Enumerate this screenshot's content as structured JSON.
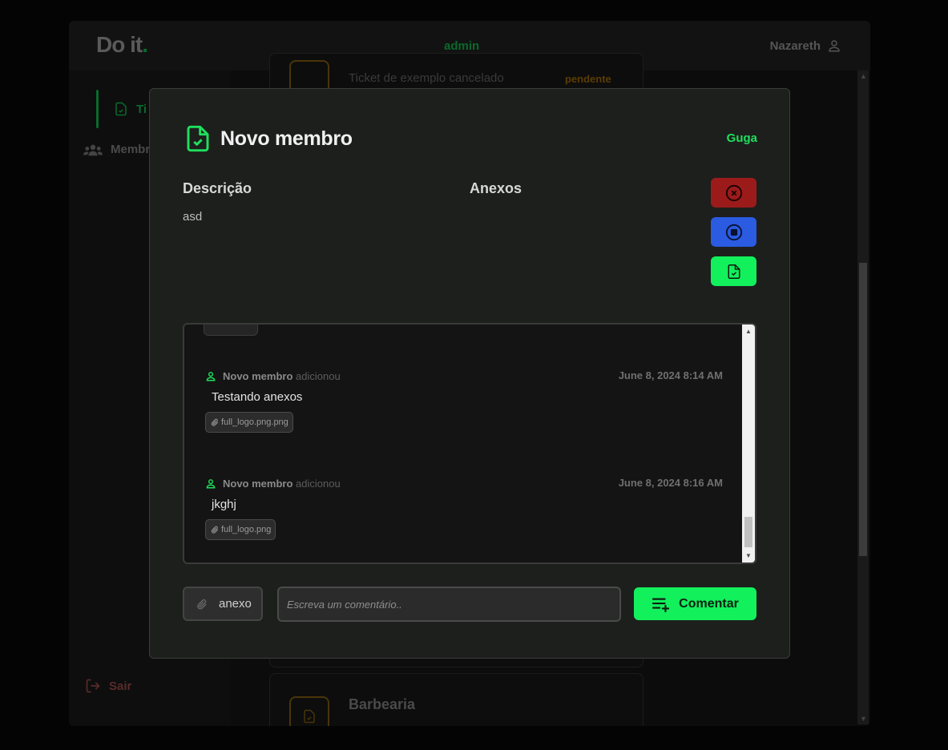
{
  "app": {
    "logo_text": "Do it",
    "logo_dot": ".",
    "role": "admin",
    "user_name": "Nazareth"
  },
  "sidebar": {
    "items": [
      {
        "label": "Ti"
      },
      {
        "label": "Membr"
      }
    ],
    "logout_label": "Sair"
  },
  "background_cards": [
    {
      "title": "Ticket de exemplo cancelado",
      "status": "pendente"
    },
    {
      "title": "Barbearia"
    }
  ],
  "modal": {
    "title": "Novo membro",
    "assignee": "Guga",
    "description_heading": "Descrição",
    "description_text": "asd",
    "attachments_heading": "Anexos",
    "actions": [
      {
        "name": "cancel",
        "icon": "x-circle-icon",
        "color": "#9b1b1b"
      },
      {
        "name": "pause",
        "icon": "stop-circle-icon",
        "color": "#2a5be0"
      },
      {
        "name": "complete",
        "icon": "file-check-icon",
        "color": "#12f05c"
      }
    ],
    "comments": [
      {
        "author": "Novo membro",
        "verb": "adicionou",
        "date": "June 8, 2024 8:14 AM",
        "text": "Testando anexos",
        "file": "full_logo.png.png"
      },
      {
        "author": "Novo membro",
        "verb": "adicionou",
        "date": "June 8, 2024 8:16 AM",
        "text": "jkghj",
        "file": "full_logo.png"
      }
    ],
    "attach_label": "anexo",
    "comment_placeholder": "Escreva um comentário..",
    "submit_label": "Comentar",
    "accent_color": "#12f05c"
  }
}
